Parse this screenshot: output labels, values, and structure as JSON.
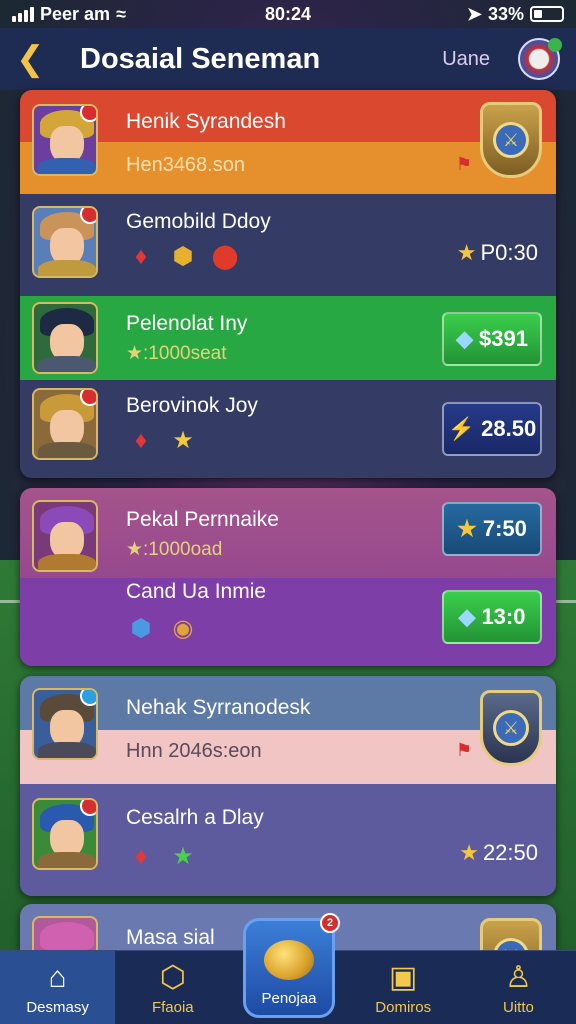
{
  "status": {
    "carrier": "Peer am",
    "time": "80:24",
    "battery": "33%"
  },
  "header": {
    "title": "Dosaial Seneman",
    "right_label": "Uane"
  },
  "rows": [
    {
      "name": "Henik Syrandesh",
      "sub": "Hen3468.son"
    },
    {
      "name": "Gemobild Ddoy",
      "price": "P0:30"
    },
    {
      "name": "Pelenolat Iny",
      "sub": "★:1000seat",
      "button": "$391"
    },
    {
      "name": "Berovinok Joy",
      "button": "28.50"
    },
    {
      "name": "Pekal Pernnaike",
      "sub": "★:1000oad",
      "button": "7:50"
    },
    {
      "name": "Cand Ua Inmie",
      "button": "13:0"
    },
    {
      "name": "Nehak Syrranodesk",
      "sub": "Hnn 2046s:eon"
    },
    {
      "name": "Cesalrh a Dlay",
      "price": "22:50"
    },
    {
      "name": "Masa sial"
    }
  ],
  "tabs": [
    "Desmasy",
    "Ffaoia",
    "Penojaa",
    "Domiros",
    "Uitto"
  ],
  "badge_count": "2"
}
